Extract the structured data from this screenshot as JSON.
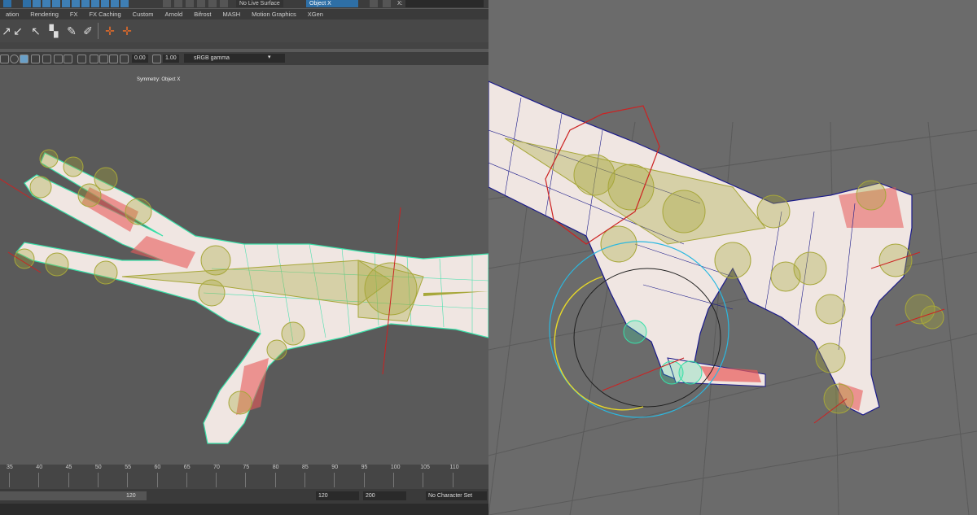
{
  "top_bar": {
    "live_surface": "No Live Surface",
    "symmetry_value": "Object X",
    "x_label": "X:"
  },
  "shelf_tabs": [
    "ation",
    "Rendering",
    "FX",
    "FX Caching",
    "Custom",
    "Arnold",
    "Bifrost",
    "MASH",
    "Motion Graphics",
    "XGen"
  ],
  "viewport_toolbar": {
    "exposure": "0.00",
    "gamma": "1.00",
    "color_space": "sRGB gamma"
  },
  "viewport": {
    "symmetry_label": "Symmetry: Object X"
  },
  "timeline": {
    "ticks": [
      "35",
      "40",
      "45",
      "50",
      "55",
      "60",
      "65",
      "70",
      "75",
      "80",
      "85",
      "90",
      "95",
      "100",
      "105",
      "110"
    ]
  },
  "range_slider": {
    "current_end": "120",
    "end": "120",
    "max": "200",
    "character_set": "No Character Set"
  },
  "colors": {
    "viewport_bg_left": "#5a5a5a",
    "viewport_bg_right": "#6b6b6b",
    "joint": "#a7a73a",
    "wire_left": "#38e0a8",
    "wire_right": "#1a1a8a",
    "skin": "#f0e6e2",
    "ctrl_red": "#cc2222",
    "ctrl_cyan": "#2ab8e0",
    "ctrl_yellow": "#e6d829"
  }
}
